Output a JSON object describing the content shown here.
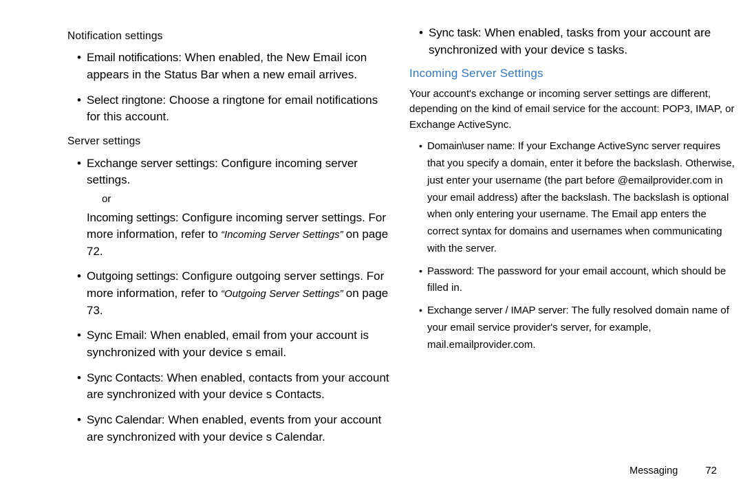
{
  "left": {
    "notif_title": "Notification settings",
    "notif_items": {
      "email_term": "Email notifications",
      "email_desc": ": When enabled, the New Email icon appears in the Status Bar when a new email arrives.",
      "ring_term": "Select ringtone",
      "ring_desc": ": Choose a ringtone for email notifications for this account."
    },
    "server_title": "Server settings",
    "server": {
      "ex_term": "Exchange server settings",
      "ex_desc": ": Configure incoming server settings.",
      "or": "or",
      "in_term": "Incoming settings",
      "in_desc": ": Configure incoming server settings. For more information, refer to",
      "in_xref": " “Incoming Server Settings” ",
      "in_page": "on page 72.",
      "out_term": "Outgoing settings",
      "out_desc": ": Configure outgoing server settings. For more information, refer to",
      "out_xref": " “Outgoing Server Settings” ",
      "out_page": "on page 73.",
      "syncE_term": "Sync Email",
      "syncE_desc": ": When enabled, email from your account is synchronized with your device s email.",
      "syncC_term": "Sync Contacts",
      "syncC_desc": ": When enabled, contacts from your account are synchronized with your device s Contacts.",
      "syncCal_term": "Sync Calendar",
      "syncCal_desc": ": When enabled, events from your account are synchronized with your device s Calendar.",
      "syncT_term": "Sync task",
      "syncT_desc": ": When enabled, tasks from your account are synchronized with your device s tasks."
    }
  },
  "right": {
    "heading": "Incoming Server Settings",
    "intro": "Your account's exchange or incoming server settings are different, depending on the kind of email service for the account: POP3, IMAP, or Exchange ActiveSync.",
    "items": {
      "dom_term": "Domain\\user name",
      "dom_desc": ": If your Exchange ActiveSync server requires that you specify a domain, enter it before the backslash. Otherwise, just enter your username (the part before @emailprovider.com in your email address) after the backslash. The backslash is optional when only entering your username. The Email app enters the correct syntax for domains and usernames when communicating with the server.",
      "pw_term": "Password",
      "pw_desc": ": The password for your email account, which should be filled in.",
      "srv_term": "Exchange server / IMAP server",
      "srv_desc": ": The fully resolved domain name of your email service provider's server, for example, mail.emailprovider.com."
    }
  },
  "footer": {
    "section": "Messaging",
    "page": "72"
  }
}
